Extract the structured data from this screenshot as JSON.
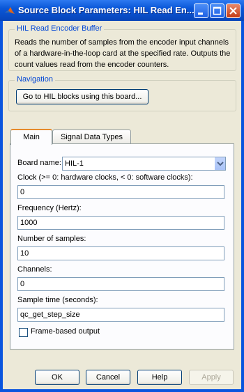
{
  "window": {
    "title": "Source Block Parameters: HIL Read En...",
    "accent_color": "#0a55de",
    "controls": [
      "minimize-icon",
      "maximize-icon",
      "close-icon"
    ]
  },
  "block_group": {
    "legend": "HIL Read Encoder Buffer",
    "description": "Reads the number of samples from the encoder input channels of a hardware-in-the-loop card at the specified rate. Outputs the count values read from the encoder counters."
  },
  "navigation": {
    "legend": "Navigation",
    "button_label": "Go to HIL blocks using this board..."
  },
  "tabs": [
    {
      "label": "Main",
      "active": true
    },
    {
      "label": "Signal Data Types",
      "active": false
    }
  ],
  "main": {
    "board_name_label": "Board name:",
    "board_name_value": "HIL-1",
    "clock_label": "Clock (>= 0: hardware clocks, < 0: software clocks):",
    "clock_value": "0",
    "frequency_label": "Frequency (Hertz):",
    "frequency_value": "1000",
    "samples_label": "Number of samples:",
    "samples_value": "10",
    "channels_label": "Channels:",
    "channels_value": "0",
    "sample_time_label": "Sample time (seconds):",
    "sample_time_value": "qc_get_step_size",
    "frame_based_label": "Frame-based output",
    "frame_based_checked": false
  },
  "footer": {
    "ok": "OK",
    "cancel": "Cancel",
    "help": "Help",
    "apply": "Apply"
  }
}
